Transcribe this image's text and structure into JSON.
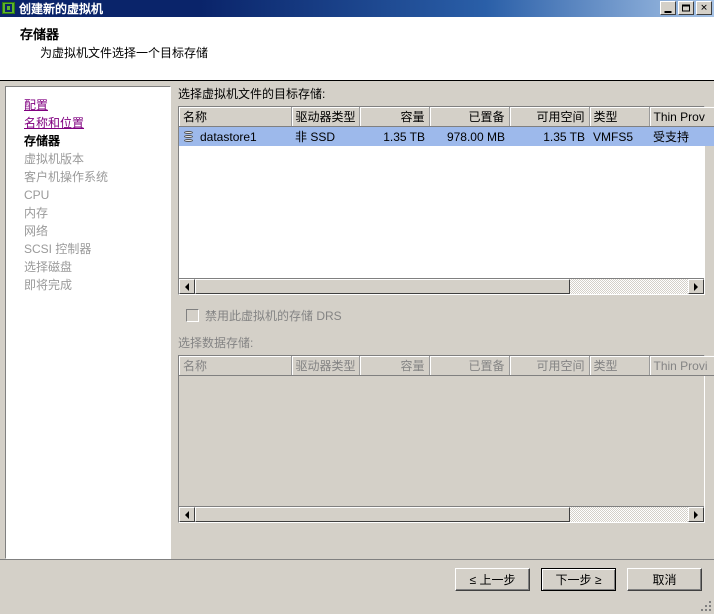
{
  "window": {
    "title": "创建新的虚拟机",
    "icon": "vm-wizard-icon",
    "minimize_label": "",
    "maximize_label": "",
    "close_label": "✕"
  },
  "header": {
    "title": "存储器",
    "subtitle": "为虚拟机文件选择一个目标存储"
  },
  "sidebar": {
    "items": [
      {
        "label": "配置",
        "state": "link"
      },
      {
        "label": "名称和位置",
        "state": "link"
      },
      {
        "label": "存储器",
        "state": "current"
      },
      {
        "label": "虚拟机版本",
        "state": "disabled"
      },
      {
        "label": "客户机操作系统",
        "state": "disabled"
      },
      {
        "label": "CPU",
        "state": "disabled"
      },
      {
        "label": "内存",
        "state": "disabled"
      },
      {
        "label": "网络",
        "state": "disabled"
      },
      {
        "label": "SCSI 控制器",
        "state": "disabled"
      },
      {
        "label": "选择磁盘",
        "state": "disabled"
      },
      {
        "label": "即将完成",
        "state": "disabled"
      }
    ]
  },
  "main": {
    "target_storage_label": "选择虚拟机文件的目标存储:",
    "storage_table": {
      "columns": [
        "名称",
        "驱动器类型",
        "容量",
        "已置备",
        "可用空间",
        "类型",
        "Thin Prov"
      ],
      "rows": [
        {
          "icon": "datastore-icon",
          "name": "datastore1",
          "drive_type": "非 SSD",
          "capacity": "1.35 TB",
          "provisioned": "978.00 MB",
          "free": "1.35 TB",
          "type": "VMFS5",
          "thin_provisioning": "受支持",
          "selected": true
        }
      ]
    },
    "disable_sdrs_checkbox": {
      "label": "禁用此虚拟机的存储 DRS",
      "checked": false,
      "enabled": false
    },
    "select_datastore_label": "选择数据存储:",
    "datastore_table": {
      "columns": [
        "名称",
        "驱动器类型",
        "容量",
        "已置备",
        "可用空间",
        "类型",
        "Thin Provi"
      ],
      "rows": []
    }
  },
  "footer": {
    "back_label": "≤ 上一步",
    "next_label": "下一步 ≥",
    "cancel_label": "取消"
  },
  "colors": {
    "title_bar_start": "#0a246a",
    "title_bar_end": "#a6c3e6",
    "window_face": "#d4d0c8",
    "selection": "#9db9eb",
    "link": "#800080",
    "disabled_text": "#848484"
  }
}
